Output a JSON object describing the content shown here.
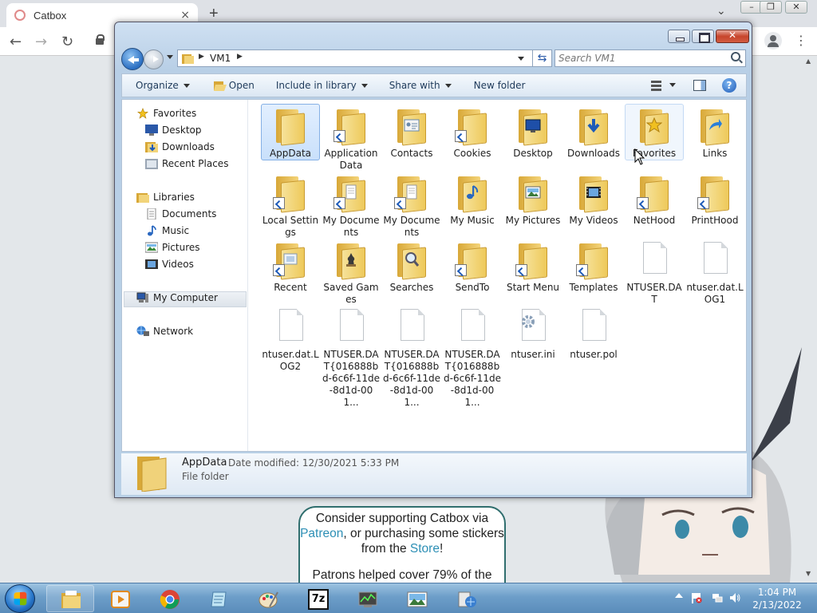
{
  "browser": {
    "tab_title": "Catbox",
    "new_tab_glyph": "+",
    "tab_close_glyph": "×",
    "dropdown_glyph": "⌄",
    "menu_glyph": "⋮",
    "back_glyph": "←",
    "forward_glyph": "→",
    "reload_glyph": "↻"
  },
  "webpage": {
    "promo_line1_pre": "Consider supporting Catbox via ",
    "promo_patreon": "Patreon",
    "promo_line1_post": ", or purchasing some stickers from the ",
    "promo_store": "Store",
    "promo_end": "!",
    "promo_line2": "Patrons helped cover 79% of the",
    "colors": {
      "link": "#2d8fb5",
      "border": "#2f6e6e"
    }
  },
  "explorer": {
    "breadcrumb": "VM1",
    "search_placeholder": "Search VM1",
    "toolbar": {
      "organize": "Organize",
      "open": "Open",
      "include": "Include in library",
      "share": "Share with",
      "newfolder": "New folder"
    },
    "nav": {
      "favorites": "Favorites",
      "desktop": "Desktop",
      "downloads": "Downloads",
      "recent": "Recent Places",
      "libraries": "Libraries",
      "documents": "Documents",
      "music": "Music",
      "pictures": "Pictures",
      "videos": "Videos",
      "mycomputer": "My Computer",
      "network": "Network"
    },
    "items": [
      {
        "label": "AppData",
        "kind": "folder"
      },
      {
        "label": "Application Data",
        "kind": "folder-shortcut"
      },
      {
        "label": "Contacts",
        "kind": "folder"
      },
      {
        "label": "Cookies",
        "kind": "folder-shortcut"
      },
      {
        "label": "Desktop",
        "kind": "folder"
      },
      {
        "label": "Downloads",
        "kind": "folder"
      },
      {
        "label": "Favorites",
        "kind": "folder"
      },
      {
        "label": "Links",
        "kind": "folder"
      },
      {
        "label": "Local Settings",
        "kind": "folder-shortcut"
      },
      {
        "label": "My Documents",
        "kind": "folder-shortcut"
      },
      {
        "label": "My Documents",
        "kind": "folder-shortcut"
      },
      {
        "label": "My Music",
        "kind": "folder"
      },
      {
        "label": "My Pictures",
        "kind": "folder"
      },
      {
        "label": "My Videos",
        "kind": "folder"
      },
      {
        "label": "NetHood",
        "kind": "folder-shortcut"
      },
      {
        "label": "PrintHood",
        "kind": "folder-shortcut"
      },
      {
        "label": "Recent",
        "kind": "folder-shortcut"
      },
      {
        "label": "Saved Games",
        "kind": "folder"
      },
      {
        "label": "Searches",
        "kind": "folder"
      },
      {
        "label": "SendTo",
        "kind": "folder-shortcut"
      },
      {
        "label": "Start Menu",
        "kind": "folder-shortcut"
      },
      {
        "label": "Templates",
        "kind": "folder-shortcut"
      },
      {
        "label": "NTUSER.DAT",
        "kind": "file"
      },
      {
        "label": "ntuser.dat.LOG1",
        "kind": "file"
      },
      {
        "label": "ntuser.dat.LOG2",
        "kind": "file"
      },
      {
        "label": "NTUSER.DAT{016888bd-6c6f-11de-8d1d-001...",
        "kind": "file"
      },
      {
        "label": "NTUSER.DAT{016888bd-6c6f-11de-8d1d-001...",
        "kind": "file"
      },
      {
        "label": "NTUSER.DAT{016888bd-6c6f-11de-8d1d-001...",
        "kind": "file"
      },
      {
        "label": "ntuser.ini",
        "kind": "settings-file"
      },
      {
        "label": "ntuser.pol",
        "kind": "file"
      }
    ],
    "details": {
      "name": "AppData",
      "modified": "Date modified: 12/30/2021 5:33 PM",
      "type": "File folder"
    },
    "selected_item": "AppData",
    "hovered_item": "Favorites"
  },
  "taskbar": {
    "time": "1:04 PM",
    "date": "2/13/2022",
    "apps": [
      "explorer-icon",
      "media-player-icon",
      "chrome-icon",
      "notepad-icon",
      "paint-icon",
      "7zip-icon",
      "task-manager-icon",
      "photo-viewer-icon",
      "network-tool-icon"
    ],
    "sevenzip_label": "7z"
  }
}
